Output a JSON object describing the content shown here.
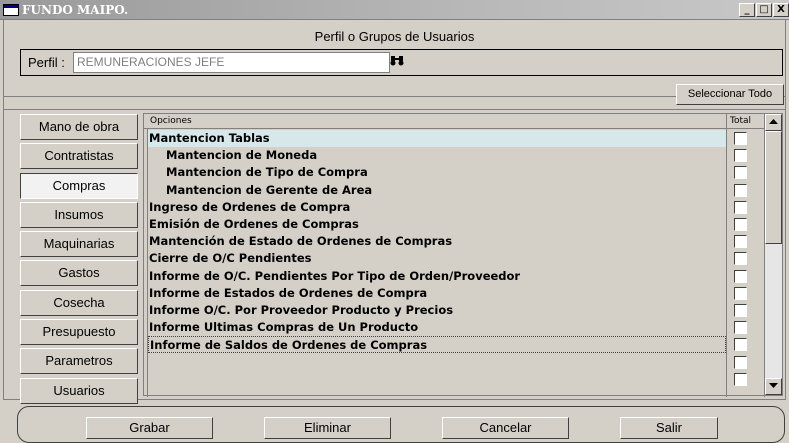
{
  "window": {
    "title": "FUNDO MAIPO.",
    "minimize_label": "_",
    "maximize_label": "□",
    "close_label": "X"
  },
  "header": {
    "subtitle": "Perfil o Grupos de Usuarios",
    "perfil_label": "Perfil :",
    "perfil_value": "REMUNERACIONES JEFE",
    "search_glyph": "🔍"
  },
  "toolbar": {
    "select_all_label": "Seleccionar Todo"
  },
  "tabs": [
    {
      "label": "Mano de obra"
    },
    {
      "label": "Contratistas"
    },
    {
      "label": "Compras"
    },
    {
      "label": "Insumos"
    },
    {
      "label": "Maquinarias"
    },
    {
      "label": "Gastos"
    },
    {
      "label": "Cosecha"
    },
    {
      "label": "Presupuesto"
    },
    {
      "label": "Parametros"
    },
    {
      "label": "Usuarios"
    }
  ],
  "active_tab": "Compras",
  "grid": {
    "col_opciones": "Opciones",
    "col_total": "Total",
    "rows": [
      {
        "label": "Mantencion Tablas",
        "level": 1,
        "checked": false
      },
      {
        "label": "Mantencion de Moneda",
        "level": 2,
        "checked": false
      },
      {
        "label": "Mantencion de Tipo de Compra",
        "level": 2,
        "checked": false
      },
      {
        "label": "Mantencion de Gerente de Area",
        "level": 2,
        "checked": false
      },
      {
        "label": "Ingreso de Ordenes de Compra",
        "level": 1,
        "checked": false
      },
      {
        "label": "Emisión de Ordenes de Compras",
        "level": 1,
        "checked": false
      },
      {
        "label": "Mantención de Estado de Ordenes de Compras",
        "level": 1,
        "checked": false
      },
      {
        "label": "Cierre de O/C Pendientes",
        "level": 1,
        "checked": false
      },
      {
        "label": "Informe de O/C. Pendientes Por Tipo de Orden/Proveedor",
        "level": 1,
        "checked": false
      },
      {
        "label": "Informe de Estados de Ordenes de Compra",
        "level": 1,
        "checked": false
      },
      {
        "label": "Informe O/C. Por Proveedor Producto y Precios",
        "level": 1,
        "checked": false
      },
      {
        "label": "Informe Ultimas Compras de Un Producto",
        "level": 1,
        "checked": false
      },
      {
        "label": "Informe de Saldos de Ordenes de Compras",
        "level": 1,
        "checked": false
      },
      {
        "label": "",
        "level": 1,
        "checked": false
      },
      {
        "label": "",
        "level": 1,
        "checked": false
      }
    ]
  },
  "footer": {
    "save_label": "Grabar",
    "delete_label": "Eliminar",
    "cancel_label": "Cancelar",
    "exit_label": "Salir"
  },
  "colors": {
    "window_bg": "#d4d0c8",
    "highlight_row": "#d7e8ea"
  }
}
